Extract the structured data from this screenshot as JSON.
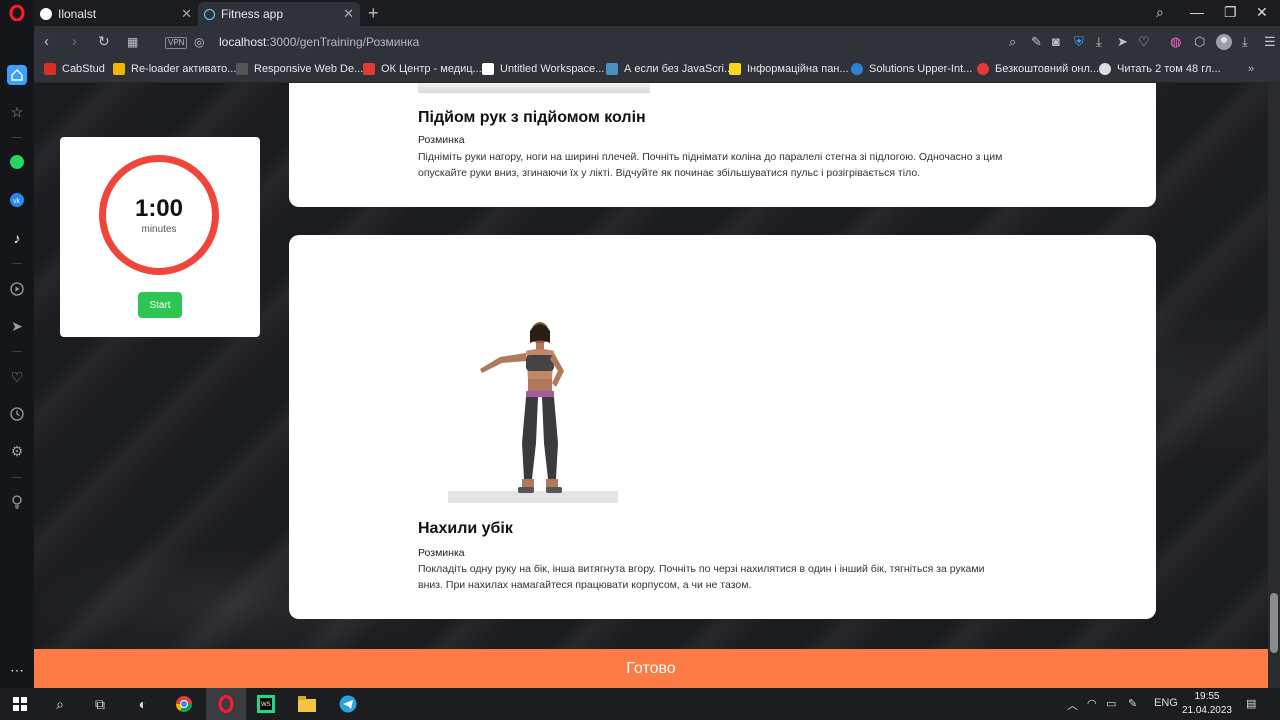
{
  "browser": {
    "tabs": [
      {
        "title": "Ilonalst",
        "favicon": "github-icon"
      },
      {
        "title": "Fitness app",
        "favicon": "react-icon",
        "active": true
      }
    ],
    "url_host": "localhost",
    "url_path": ":3000/genTraining/Розминка",
    "vpn_label": "VPN",
    "bookmarks": [
      {
        "label": "CabStud",
        "color": "#d93025"
      },
      {
        "label": "Re-loader активато...",
        "color": "#f4b400"
      },
      {
        "label": "Responsive Web De...",
        "color": "#555555"
      },
      {
        "label": "ОК Центр - медиц...",
        "color": "#e53935"
      },
      {
        "label": "Untitled Workspace...",
        "color": "#ffffff"
      },
      {
        "label": "А если без JavaScri...",
        "color": "#4a90c2"
      },
      {
        "label": "Інформаційна пан...",
        "color": "#f9d71c"
      },
      {
        "label": "Solutions Upper-Int...",
        "color": "#2e7dd7"
      },
      {
        "label": "Безкоштовний онл...",
        "color": "#e53935"
      },
      {
        "label": "Читать 2 том 48 гл...",
        "color": "#dddddd"
      }
    ]
  },
  "timer": {
    "time": "1:00",
    "unit": "minutes",
    "start_label": "Start"
  },
  "exercises": [
    {
      "title": "Підйом рук з підйомом колін",
      "category": "Розминка",
      "description": "Підніміть руки нагору, ноги на ширині плечей. Почніть піднімати коліна до паралелі стегна зі підлогою. Одночасно з цим опускайте руки вниз, згинаючи їх у лікті. Відчуйте як починає збільшуватися пульс і розігрівається тіло."
    },
    {
      "title": "Нахили убік",
      "category": "Розминка",
      "description": "Покладіть одну руку на бік, інша витягнута вгору. Почніть по черзі нахилятися в один і інший бік, тягніться за руками вниз. При нахилах намагайтеся працювати корпусом, а чи не тазом."
    }
  ],
  "done_label": "Готово",
  "taskbar": {
    "language": "ENG",
    "time": "19:55",
    "date": "21.04.2023"
  },
  "colors": {
    "accent_orange": "#ff7b45",
    "timer_red": "#f0453a",
    "start_green": "#2dc653"
  }
}
